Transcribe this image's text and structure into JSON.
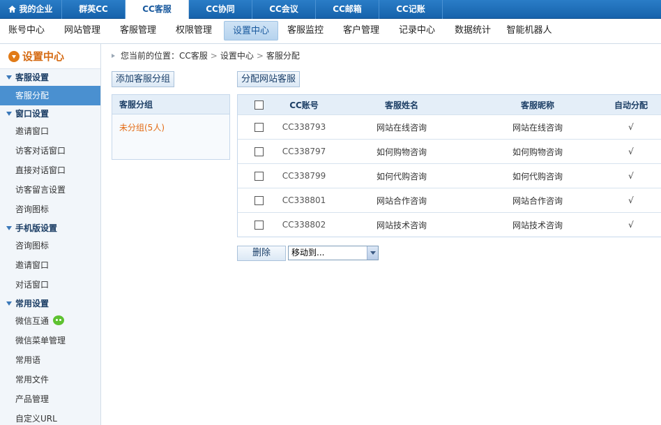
{
  "top_tabs": [
    {
      "label": "我的企业"
    },
    {
      "label": "群英CC"
    },
    {
      "label": "CC客服"
    },
    {
      "label": "CC协同"
    },
    {
      "label": "CC会议"
    },
    {
      "label": "CC邮箱"
    },
    {
      "label": "CC记账"
    }
  ],
  "sub_tabs": [
    {
      "label": "账号中心"
    },
    {
      "label": "网站管理"
    },
    {
      "label": "客服管理"
    },
    {
      "label": "权限管理"
    },
    {
      "label": "设置中心"
    },
    {
      "label": "客服监控"
    },
    {
      "label": "客户管理"
    },
    {
      "label": "记录中心"
    },
    {
      "label": "数据统计"
    },
    {
      "label": "智能机器人"
    }
  ],
  "sidebar": {
    "title": "设置中心",
    "groups": [
      {
        "label": "客服设置",
        "items": [
          "客服分配"
        ]
      },
      {
        "label": "窗口设置",
        "items": [
          "邀请窗口",
          "访客对话窗口",
          "直接对话窗口",
          "访客留言设置",
          "咨询图标"
        ]
      },
      {
        "label": "手机版设置",
        "items": [
          "咨询图标",
          "邀请窗口",
          "对话窗口"
        ]
      },
      {
        "label": "常用设置",
        "items": [
          "微信互通",
          "微信菜单管理",
          "常用语",
          "常用文件",
          "产品管理",
          "自定义URL"
        ]
      }
    ]
  },
  "breadcrumb": {
    "prefix": "您当前的位置：",
    "parts": [
      "CC客服",
      "设置中心",
      "客服分配"
    ],
    "sep": ">"
  },
  "buttons": {
    "add_group": "添加客服分组",
    "assign": "分配网站客服",
    "delete": "删除"
  },
  "group_panel": {
    "header": "客服分组",
    "items": [
      "未分组(5人)"
    ]
  },
  "table": {
    "headers": [
      "CC账号",
      "客服姓名",
      "客服昵称",
      "自动分配"
    ],
    "rows": [
      {
        "account": "CC338793",
        "name": "网站在线咨询",
        "nick": "网站在线咨询",
        "auto": "√"
      },
      {
        "account": "CC338797",
        "name": "如何购物咨询",
        "nick": "如何购物咨询",
        "auto": "√"
      },
      {
        "account": "CC338799",
        "name": "如何代购咨询",
        "nick": "如何代购咨询",
        "auto": "√"
      },
      {
        "account": "CC338801",
        "name": "网站合作咨询",
        "nick": "网站合作咨询",
        "auto": "√"
      },
      {
        "account": "CC338802",
        "name": "网站技术咨询",
        "nick": "网站技术咨询",
        "auto": "√"
      }
    ]
  },
  "move_select": {
    "value": "移动到..."
  }
}
